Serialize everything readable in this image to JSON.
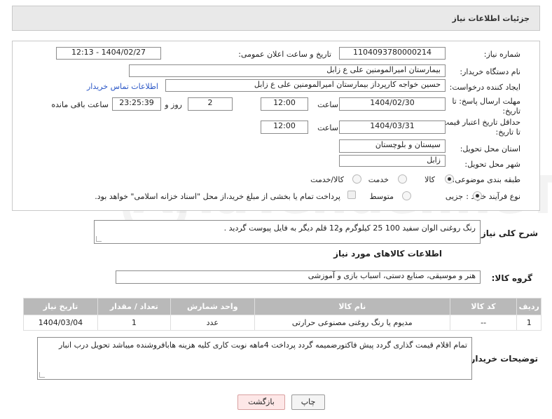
{
  "header": {
    "title": "جزئیات اطلاعات نیاز"
  },
  "form": {
    "need_number_label": "شماره نیاز:",
    "need_number": "1104093780000214",
    "announce_label": "تاریخ و ساعت اعلان عمومی:",
    "announce_value": "1404/02/27 - 12:13",
    "buyer_org_label": "نام دستگاه خریدار:",
    "buyer_org": "بیمارستان امیرالمومنین علی  ع  زابل",
    "requester_label": "ایجاد کننده درخواست:",
    "requester": "حسین خواجه کارپرداز بیمارستان امیرالمومنین علی  ع  زابل",
    "buyer_contact_link": "اطلاعات تماس خریدار",
    "deadline_label_1": "مهلت ارسال پاسخ: تا",
    "deadline_label_2": "تاریخ:",
    "deadline_date": "1404/02/30",
    "time_word": "ساعت",
    "deadline_time": "12:00",
    "days_value": "2",
    "days_word": "روز و",
    "remaining_time": "23:25:39",
    "remaining_word": "ساعت باقی مانده",
    "validity_label_1": "حداقل تاریخ اعتبار قیمت:",
    "validity_label_2": "تا تاریخ:",
    "validity_date": "1404/03/31",
    "validity_time": "12:00",
    "province_label": "استان محل تحویل:",
    "province": "سیستان و بلوچستان",
    "city_label": "شهر محل تحویل:",
    "city": "زابل",
    "category_label": "طبقه بندی موضوعی:",
    "category_options": [
      "کالا",
      "خدمت",
      "کالا/خدمت"
    ],
    "category_selected": "کالا",
    "process_label": "نوع فرآیند خرید :",
    "process_options": [
      "جزیی",
      "متوسط"
    ],
    "process_selected": "جزیی",
    "payment_note": "پرداخت تمام یا بخشی از مبلغ خرید،از محل \"اسناد خزانه اسلامی\" خواهد بود."
  },
  "description": {
    "label": "شرح کلی نیاز:",
    "text": "رنگ روغنی الوان سفید 100 25 کیلوگرم و12 قلم دیگر به فایل پیوست گردید ."
  },
  "goods": {
    "section_title": "اطلاعات کالاهای مورد نیاز",
    "group_label": "گروه کالا:",
    "group_value": "هنر و موسیقی، صنایع دستی، اسباب بازی و آموزشی",
    "columns": [
      "ردیف",
      "کد کالا",
      "نام کالا",
      "واحد شمارش",
      "تعداد / مقدار",
      "تاریخ نیاز"
    ],
    "rows": [
      [
        "1",
        "--",
        "مدیوم یا رنگ روغنی مصنوعی حرارتی",
        "عدد",
        "1",
        "1404/03/04"
      ]
    ]
  },
  "buyer_notes": {
    "label": "توضیحات خریدار:",
    "text": "تمام اقلام قیمت گذاری گردد پیش فاکتورضمیمه گردد پرداخت 4ماهه نوبت کاری کلیه هزینه هابافروشنده میباشد تحویل درب انبار"
  },
  "buttons": {
    "print": "چاپ",
    "back": "بازگشت"
  },
  "colors": {
    "link": "#2a56c6",
    "table_header": "#b9b9b9",
    "back_button": "#fde7e7"
  }
}
